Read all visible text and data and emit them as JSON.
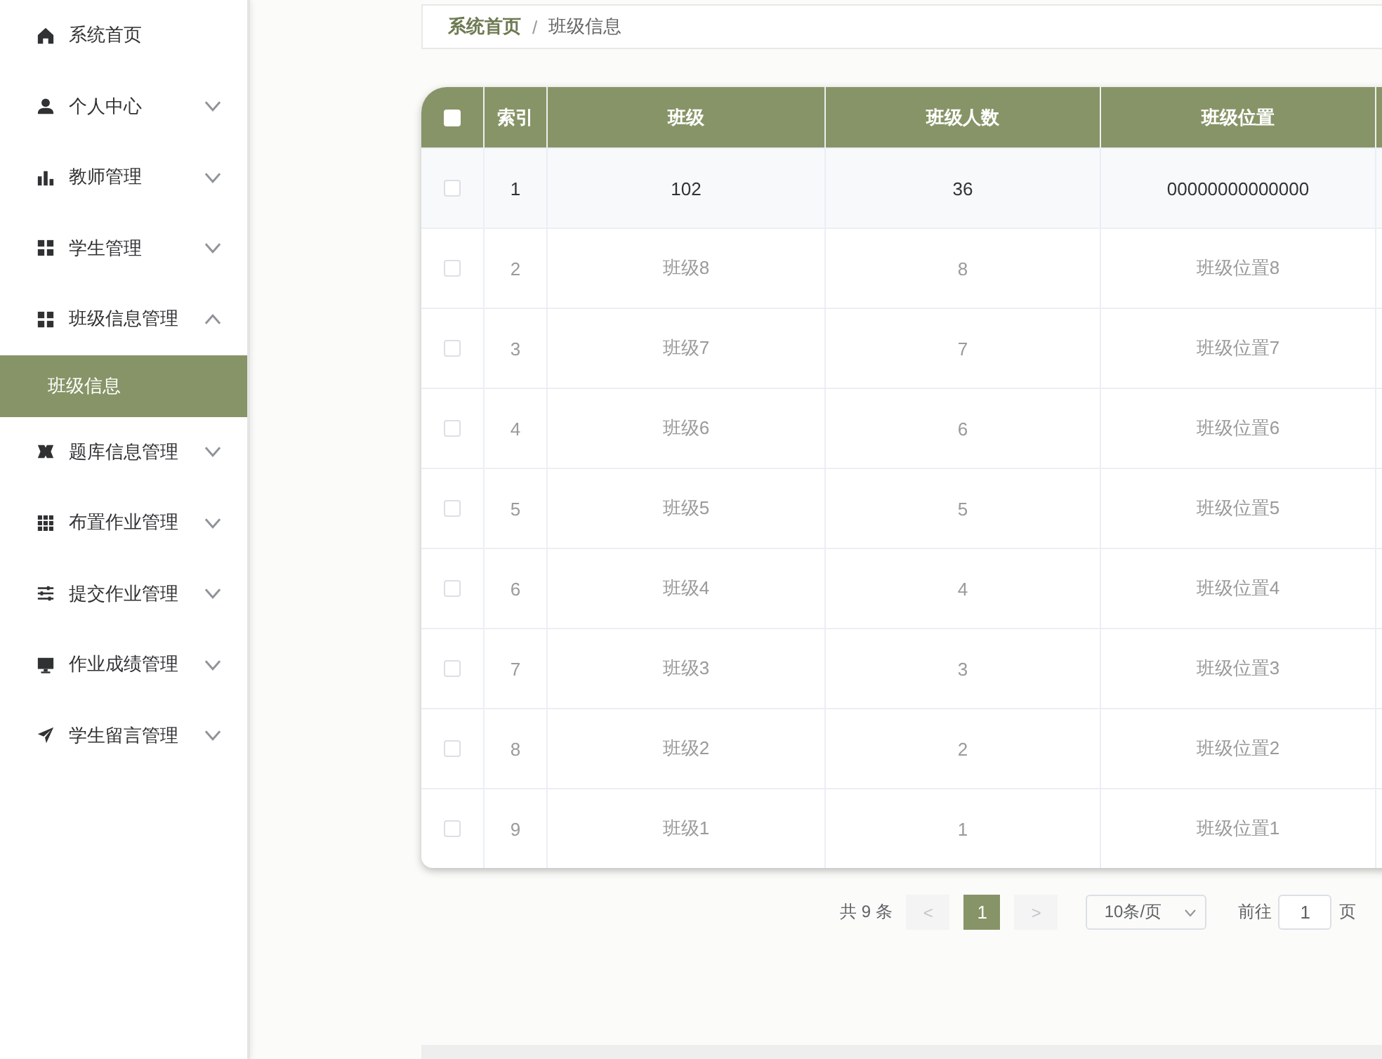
{
  "sidebar": {
    "items": [
      {
        "label": "系统首页"
      },
      {
        "label": "个人中心",
        "expanded": false
      },
      {
        "label": "教师管理",
        "expanded": false
      },
      {
        "label": "学生管理",
        "expanded": false
      },
      {
        "label": "班级信息管理",
        "expanded": true,
        "children": [
          {
            "label": "班级信息",
            "selected": true
          }
        ]
      },
      {
        "label": "题库信息管理",
        "expanded": false
      },
      {
        "label": "布置作业管理",
        "expanded": false
      },
      {
        "label": "提交作业管理",
        "expanded": false
      },
      {
        "label": "作业成绩管理",
        "expanded": false
      },
      {
        "label": "学生留言管理",
        "expanded": false
      }
    ]
  },
  "breadcrumb": [
    "系统首页",
    "班级信息"
  ],
  "breadcrumb_separator": "/",
  "table": {
    "select_all_checked": false,
    "columns": [
      "索引",
      "班级",
      "班级人数",
      "班级位置"
    ],
    "rows": [
      {
        "checked": false,
        "highlighted": true,
        "cells": [
          "1",
          "102",
          "36",
          "00000000000000"
        ]
      },
      {
        "checked": false,
        "highlighted": false,
        "cells": [
          "2",
          "班级8",
          "8",
          "班级位置8"
        ]
      },
      {
        "checked": false,
        "highlighted": false,
        "cells": [
          "3",
          "班级7",
          "7",
          "班级位置7"
        ]
      },
      {
        "checked": false,
        "highlighted": false,
        "cells": [
          "4",
          "班级6",
          "6",
          "班级位置6"
        ]
      },
      {
        "checked": false,
        "highlighted": false,
        "cells": [
          "5",
          "班级5",
          "5",
          "班级位置5"
        ]
      },
      {
        "checked": false,
        "highlighted": false,
        "cells": [
          "6",
          "班级4",
          "4",
          "班级位置4"
        ]
      },
      {
        "checked": false,
        "highlighted": false,
        "cells": [
          "7",
          "班级3",
          "3",
          "班级位置3"
        ]
      },
      {
        "checked": false,
        "highlighted": false,
        "cells": [
          "8",
          "班级2",
          "2",
          "班级位置2"
        ]
      },
      {
        "checked": false,
        "highlighted": false,
        "cells": [
          "9",
          "班级1",
          "1",
          "班级位置1"
        ]
      }
    ]
  },
  "pagination": {
    "total": "共 9 条",
    "prev": "<",
    "pages": [
      {
        "label": "1",
        "selected": true
      }
    ],
    "next": ">",
    "page_size": "10条/页",
    "goto_label": "前往",
    "goto_value": "1",
    "page_unit": "页"
  }
}
